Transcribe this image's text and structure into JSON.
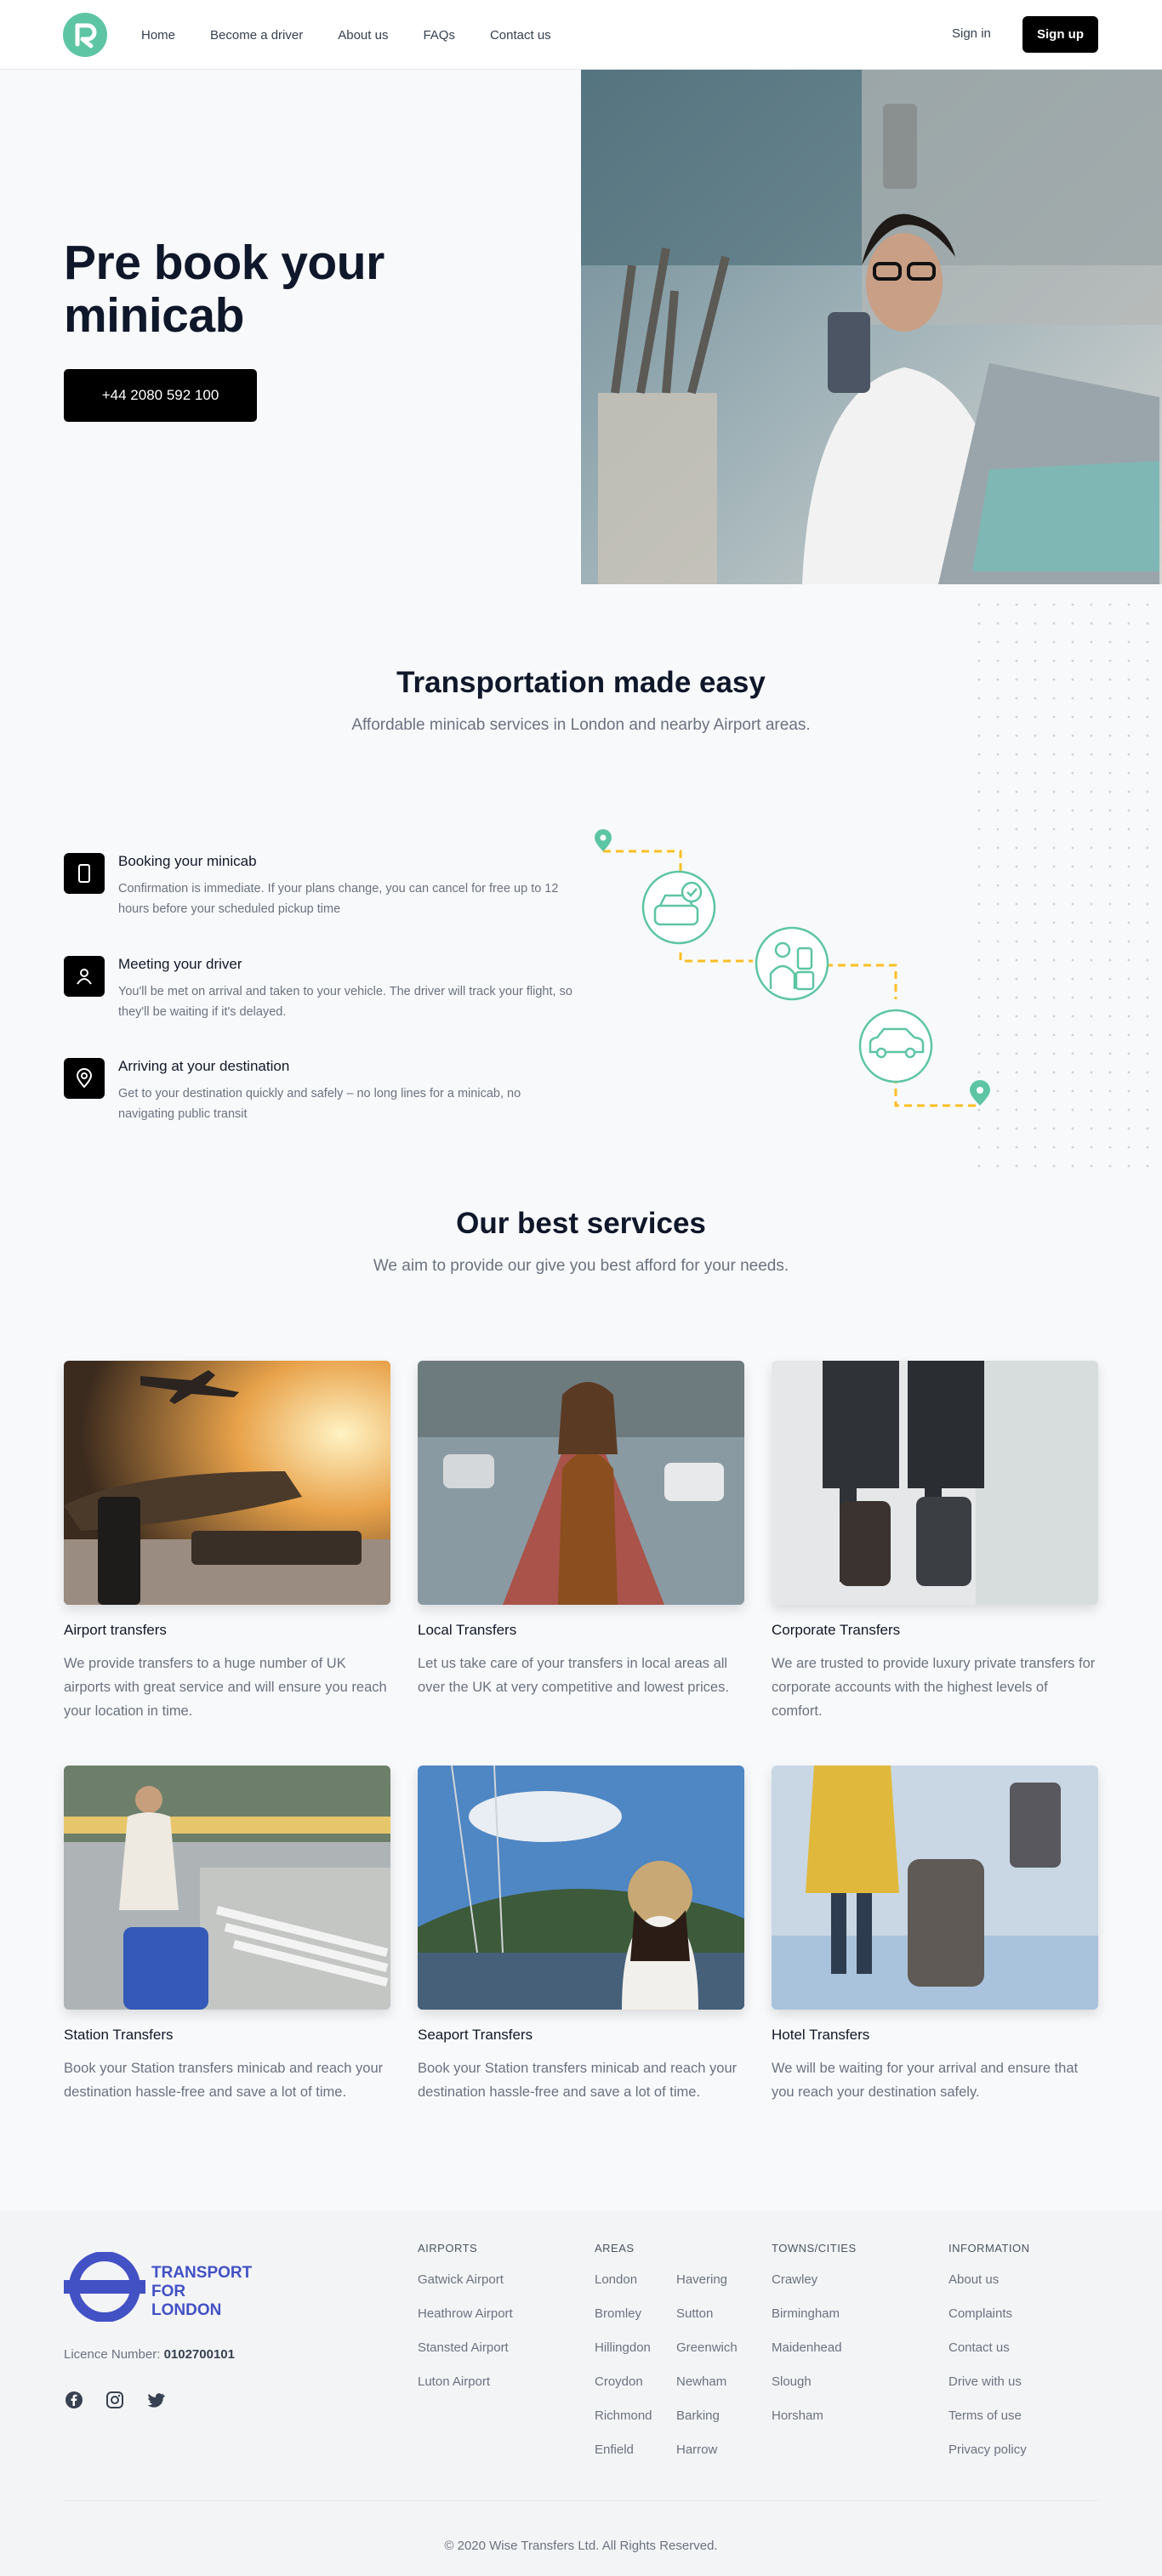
{
  "nav": {
    "links": [
      "Home",
      "Become a driver",
      "About us",
      "FAQs",
      "Contact us"
    ],
    "sign_in": "Sign in",
    "sign_up": "Sign up"
  },
  "hero": {
    "title_line1": "Pre book your",
    "title_line2": "minicab",
    "phone_button": "+44 2080 592 100"
  },
  "transport": {
    "title": "Transportation made easy",
    "subtitle": "Affordable minicab services in London and nearby Airport areas.",
    "steps": [
      {
        "icon": "phone-icon",
        "title": "Booking your minicab",
        "text": "Confirmation is immediate. If your plans change, you can cancel for free up to 12 hours before your scheduled pickup time"
      },
      {
        "icon": "user-icon",
        "title": "Meeting your driver",
        "text": "You'll be met on arrival and taken to your vehicle. The driver will track your flight, so they'll be waiting if it's delayed."
      },
      {
        "icon": "location-pin-icon",
        "title": "Arriving at your destination",
        "text": "Get to your destination quickly and safely – no long lines for a minicab, no navigating public transit"
      }
    ]
  },
  "services": {
    "title": "Our best services",
    "subtitle": "We aim to provide our give you best afford for your needs.",
    "cards": [
      {
        "title": "Airport transfers",
        "text": "We provide transfers to a huge number of UK airports with great service and will ensure you reach your location in time."
      },
      {
        "title": "Local Transfers",
        "text": "Let us take care of your transfers in local areas all over the UK at very competitive and lowest prices."
      },
      {
        "title": "Corporate Transfers",
        "text": "We are trusted to provide luxury private transfers for corporate accounts with the highest levels of comfort."
      },
      {
        "title": "Station Transfers",
        "text": "Book your Station transfers minicab and reach your destination hassle-free and save a lot of time."
      },
      {
        "title": "Seaport Transfers",
        "text": "Book your Station transfers minicab and reach your destination hassle-free and save a lot of time."
      },
      {
        "title": "Hotel Transfers",
        "text": "We will be waiting for your arrival and ensure that you reach your destination safely."
      }
    ]
  },
  "footer": {
    "brand_line1": "TRANSPORT",
    "brand_line2": "FOR LONDON",
    "licence_label": "Licence Number:",
    "licence_number": "0102700101",
    "airports_head": "AIRPORTS",
    "airports": [
      "Gatwick Airport",
      "Heathrow Airport",
      "Stansted Airport",
      "Luton Airport"
    ],
    "areas_head": "AREAS",
    "areas_col1": [
      "London",
      "Bromley",
      "Hillingdon",
      "Croydon",
      "Richmond",
      "Enfield"
    ],
    "areas_col2": [
      "Havering",
      "Sutton",
      "Greenwich",
      "Newham",
      "Barking",
      "Harrow"
    ],
    "towns_head": "TOWNS/CITIES",
    "towns": [
      "Crawley",
      "Birmingham",
      "Maidenhead",
      "Slough",
      "Horsham"
    ],
    "info_head": "INFORMATION",
    "info": [
      "About us",
      "Complaints",
      "Contact us",
      "Drive with us",
      "Terms of use",
      "Privacy policy"
    ],
    "copyright": "© 2020 Wise Transfers Ltd. All Rights Reserved."
  }
}
